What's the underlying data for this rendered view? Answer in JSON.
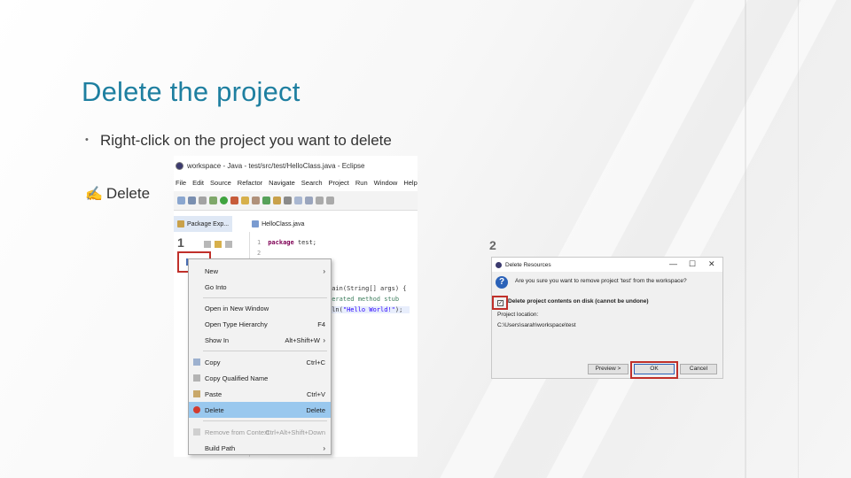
{
  "slide": {
    "title": "Delete the project",
    "bullet_mark": "•",
    "bullet1": "Right-click on the project you want to delete",
    "arrow_glyph": "✍",
    "bullet2": "Delete",
    "step1": "1",
    "step2": "2"
  },
  "eclipse": {
    "window_title": "workspace - Java - test/src/test/HelloClass.java - Eclipse",
    "menu": [
      "File",
      "Edit",
      "Source",
      "Refactor",
      "Navigate",
      "Search",
      "Project",
      "Run",
      "Window",
      "Help"
    ],
    "tabs": {
      "package_explorer": "Package Exp...",
      "editor_file": "HelloClass.java"
    },
    "code": {
      "line1_num": "1",
      "line1_kw": "package",
      "line1_rest": " test;",
      "line2_num": "2",
      "brace": "{",
      "main_sig": "main(String[] args) {",
      "stub_comment": "nerated method stub",
      "println": "tln(",
      "println_str": "\"Hello World!\"",
      "println_end": ");"
    },
    "context_menu": [
      {
        "label": "New",
        "shortcut": "",
        "submenu": true
      },
      {
        "label": "Go Into",
        "shortcut": "",
        "submenu": false
      },
      {
        "label": "Open in New Window",
        "shortcut": "",
        "submenu": false
      },
      {
        "label": "Open Type Hierarchy",
        "shortcut": "F4",
        "submenu": false
      },
      {
        "label": "Show In",
        "shortcut": "Alt+Shift+W",
        "submenu": true
      },
      {
        "label": "Copy",
        "shortcut": "Ctrl+C",
        "submenu": false
      },
      {
        "label": "Copy Qualified Name",
        "shortcut": "",
        "submenu": false
      },
      {
        "label": "Paste",
        "shortcut": "Ctrl+V",
        "submenu": false
      },
      {
        "label": "Delete",
        "shortcut": "Delete",
        "submenu": false,
        "selected": true
      },
      {
        "label": "Remove from Context",
        "shortcut": "Ctrl+Alt+Shift+Down",
        "submenu": false,
        "disabled": true
      },
      {
        "label": "Build Path",
        "shortcut": "",
        "submenu": true
      }
    ]
  },
  "dialog": {
    "title": "Delete Resources",
    "question": "Are you sure you want to remove project 'test' from the workspace?",
    "checkbox_label": "Delete project contents on disk (cannot be undone)",
    "location_label": "Project location:",
    "location_value": "C:\\Users\\sarah\\workspace\\test",
    "buttons": {
      "preview": "Preview >",
      "ok": "OK",
      "cancel": "Cancel"
    },
    "window_controls": {
      "minimize": "—",
      "maximize": "☐",
      "close": "✕"
    }
  },
  "colors": {
    "title": "#1e7fa0",
    "highlight_frame": "#c0302a",
    "menu_selection": "#99c8ee"
  }
}
